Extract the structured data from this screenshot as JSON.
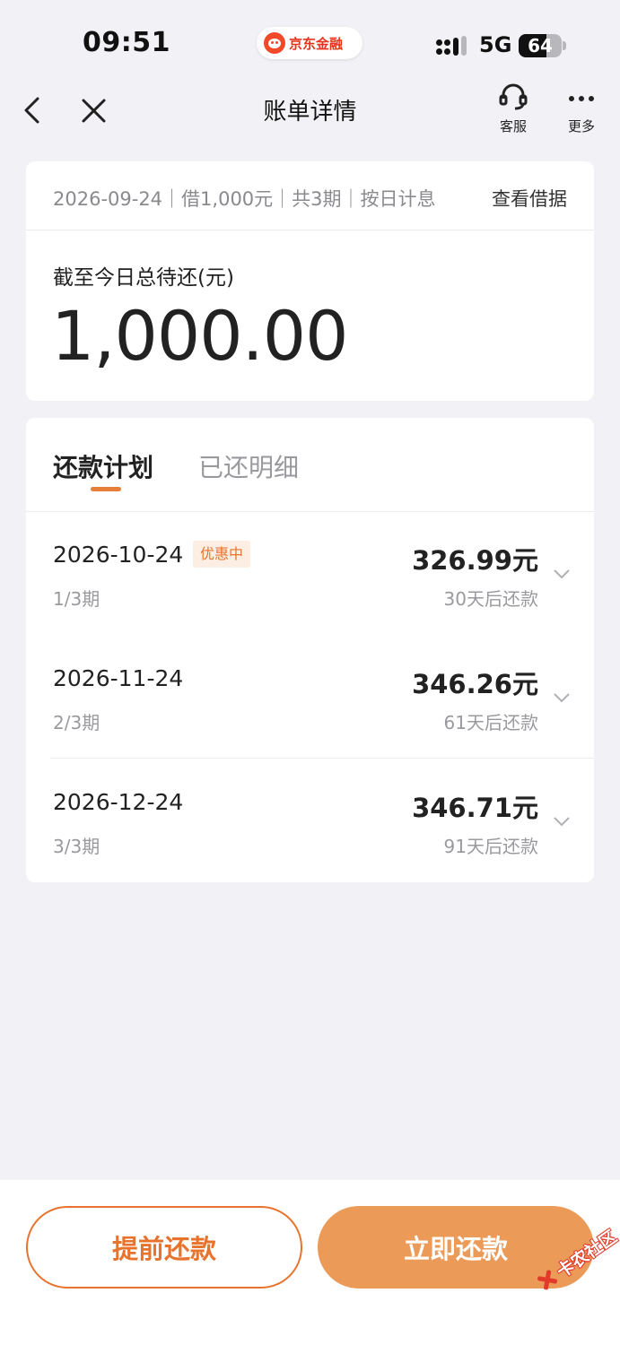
{
  "status_bar": {
    "time": "09:51",
    "brand": "京东金融",
    "network": "5G",
    "battery_percent": 64,
    "battery_label": "64",
    "icons": [
      "signal-icon",
      "battery-icon"
    ]
  },
  "navbar": {
    "title": "账单详情",
    "service_label": "客服",
    "more_label": "更多",
    "icons": [
      "back-arrow-icon",
      "close-icon",
      "headset-icon",
      "more-dots-icon"
    ]
  },
  "summary": {
    "meta": "2026-09-24｜借1,000元｜共3期｜按日计息",
    "link": "查看借据",
    "total_label": "截至今日总待还(元)",
    "total_amount": "1,000.00"
  },
  "tabs": {
    "plan": "还款计划",
    "history": "已还明细",
    "active": "plan"
  },
  "installments": [
    {
      "date": "2026-10-24",
      "badge": "优惠中",
      "period": "1/3期",
      "amount": "326.99元",
      "due": "30天后还款"
    },
    {
      "date": "2026-11-24",
      "badge": "",
      "period": "2/3期",
      "amount": "346.26元",
      "due": "61天后还款"
    },
    {
      "date": "2026-12-24",
      "badge": "",
      "period": "3/3期",
      "amount": "346.71元",
      "due": "91天后还款"
    }
  ],
  "actions": {
    "prepay": "提前还款",
    "pay_now": "立即还款"
  },
  "watermark": {
    "text": "卡农社区"
  },
  "colors": {
    "accent": "#e8732c",
    "accent_fill": "#ec9a58",
    "background": "#f2f2f6",
    "muted_text": "#9a9a9e"
  }
}
